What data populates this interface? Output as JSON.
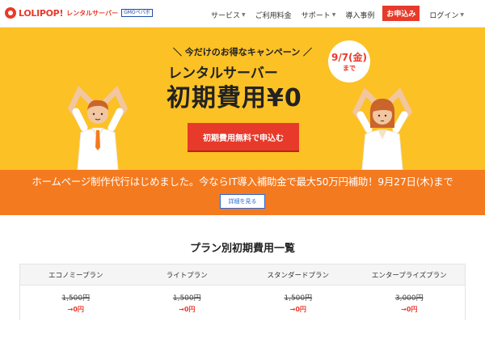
{
  "header": {
    "logo_text": "LOLIPOP!",
    "logo_sub": "レンタルサーバー",
    "logo_partner": "GMOペパボ",
    "nav": [
      {
        "label": "サービス",
        "dropdown": true
      },
      {
        "label": "ご利用料金",
        "dropdown": false
      },
      {
        "label": "サポート",
        "dropdown": true
      },
      {
        "label": "導入事例",
        "dropdown": false
      }
    ],
    "apply_label": "お申込み",
    "login_label": "ログイン"
  },
  "hero": {
    "tagline": "＼ 今だけのお得なキャンペーン ／",
    "title_line1": "レンタルサーバー",
    "title_line2": "初期費用¥0",
    "deadline_date": "9/7(金)",
    "deadline_suffix": "まで",
    "cta_label": "初期費用無料で申込む"
  },
  "banner": {
    "text": "ホームページ制作代行はじめました。今ならIT導入補助金で最大50万円補助！9月27日(木)まで",
    "button_label": "詳細を見る"
  },
  "plans": {
    "title": "プラン別初期費用一覧",
    "items": [
      {
        "name": "エコノミープラン",
        "old_price": "1,500円",
        "new_price": "0円"
      },
      {
        "name": "ライトプラン",
        "old_price": "1,500円",
        "new_price": "0円"
      },
      {
        "name": "スタンダードプラン",
        "old_price": "1,500円",
        "new_price": "0円"
      },
      {
        "name": "エンタープライズプラン",
        "old_price": "3,000円",
        "new_price": "0円"
      }
    ]
  },
  "colors": {
    "brand_red": "#e83a2b",
    "hero_yellow": "#fcc125",
    "banner_orange": "#f47a1f",
    "link_blue": "#2a6bd6"
  }
}
